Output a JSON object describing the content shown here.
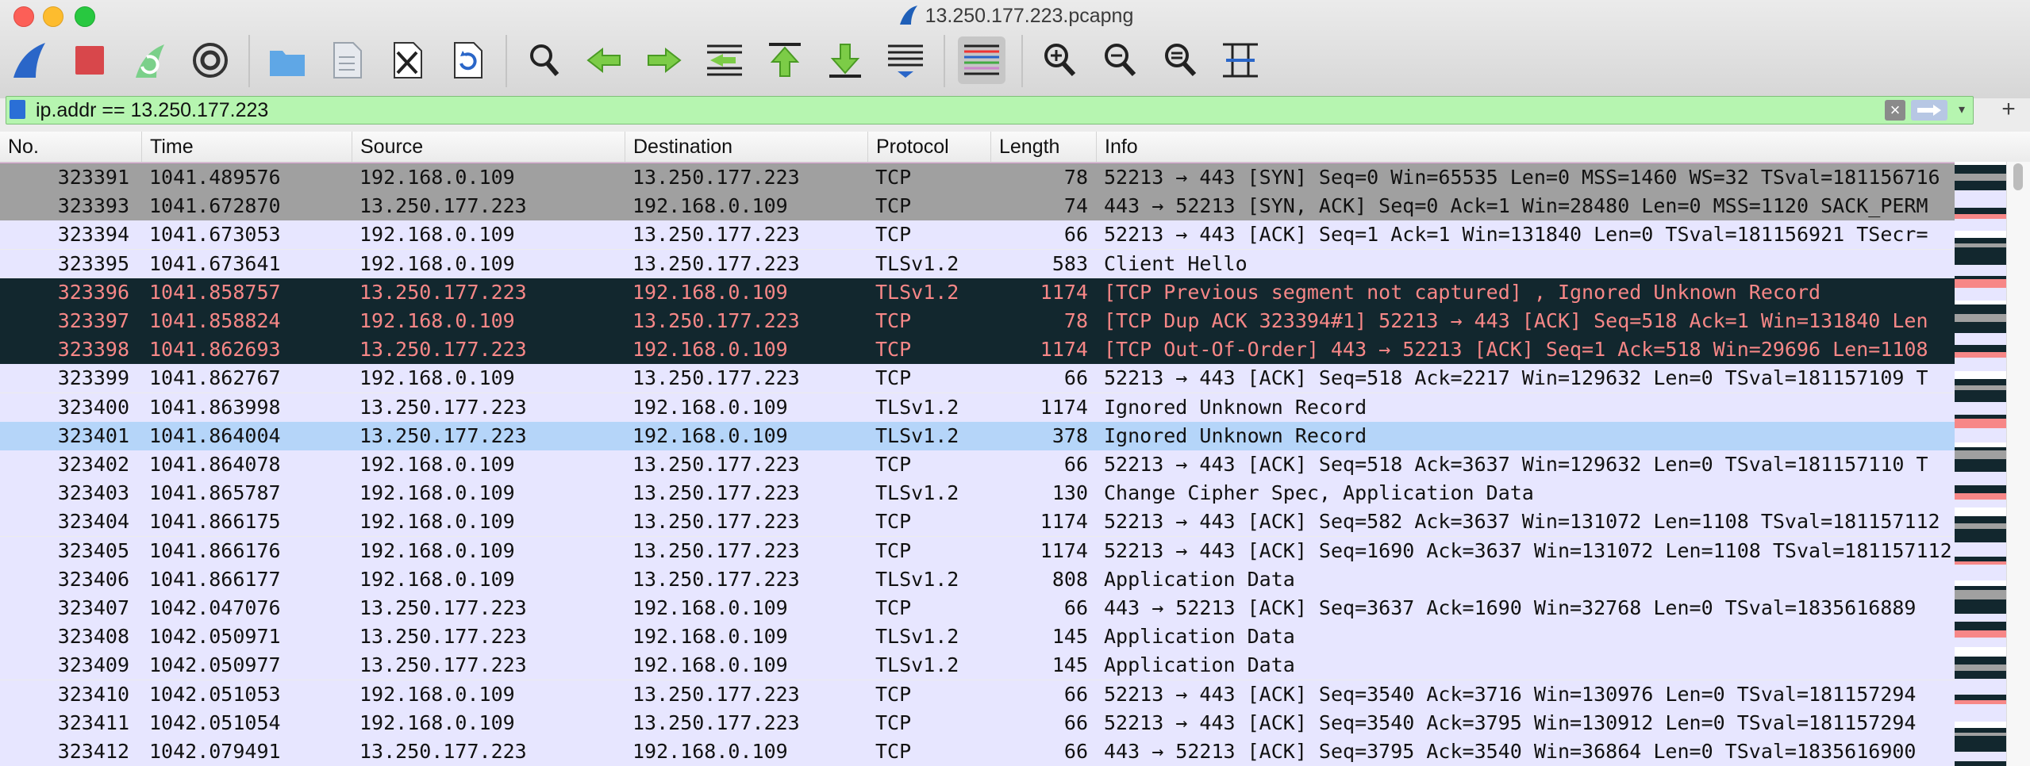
{
  "window": {
    "title": "13.250.177.223.pcapng"
  },
  "filter": {
    "value": "ip.addr == 13.250.177.223"
  },
  "columns": [
    "No.",
    "Time",
    "Source",
    "Destination",
    "Protocol",
    "Length",
    "Info"
  ],
  "colors": {
    "syn_bg": "#a0a0a0",
    "tcp_bg": "#e7e6ff",
    "bad_bg": "#12272e",
    "bad_fg": "#f78787",
    "selected_bg": "#b5d5f9",
    "filter_valid_bg": "#b6f5b0"
  },
  "rows": [
    {
      "no": "323391",
      "time": "1041.489576",
      "src": "192.168.0.109",
      "dst": "13.250.177.223",
      "proto": "TCP",
      "len": "78",
      "info": "52213 → 443 [SYN] Seq=0 Win=65535 Len=0 MSS=1460 WS=32 TSval=181156716",
      "style": "syn"
    },
    {
      "no": "323393",
      "time": "1041.672870",
      "src": "13.250.177.223",
      "dst": "192.168.0.109",
      "proto": "TCP",
      "len": "74",
      "info": "443 → 52213 [SYN, ACK] Seq=0 Ack=1 Win=28480 Len=0 MSS=1120 SACK_PERM",
      "style": "syn"
    },
    {
      "no": "323394",
      "time": "1041.673053",
      "src": "192.168.0.109",
      "dst": "13.250.177.223",
      "proto": "TCP",
      "len": "66",
      "info": "52213 → 443 [ACK] Seq=1 Ack=1 Win=131840 Len=0 TSval=181156921 TSecr=",
      "style": "tcp"
    },
    {
      "no": "323395",
      "time": "1041.673641",
      "src": "192.168.0.109",
      "dst": "13.250.177.223",
      "proto": "TLSv1.2",
      "len": "583",
      "info": "Client Hello",
      "style": "tcp"
    },
    {
      "no": "323396",
      "time": "1041.858757",
      "src": "13.250.177.223",
      "dst": "192.168.0.109",
      "proto": "TLSv1.2",
      "len": "1174",
      "info": "[TCP Previous segment not captured] , Ignored Unknown Record",
      "style": "bad"
    },
    {
      "no": "323397",
      "time": "1041.858824",
      "src": "192.168.0.109",
      "dst": "13.250.177.223",
      "proto": "TCP",
      "len": "78",
      "info": "[TCP Dup ACK 323394#1] 52213 → 443 [ACK] Seq=518 Ack=1 Win=131840 Len",
      "style": "bad"
    },
    {
      "no": "323398",
      "time": "1041.862693",
      "src": "13.250.177.223",
      "dst": "192.168.0.109",
      "proto": "TCP",
      "len": "1174",
      "info": "[TCP Out-Of-Order] 443 → 52213 [ACK] Seq=1 Ack=518 Win=29696 Len=1108",
      "style": "bad"
    },
    {
      "no": "323399",
      "time": "1041.862767",
      "src": "192.168.0.109",
      "dst": "13.250.177.223",
      "proto": "TCP",
      "len": "66",
      "info": "52213 → 443 [ACK] Seq=518 Ack=2217 Win=129632 Len=0 TSval=181157109 T",
      "style": "tcp"
    },
    {
      "no": "323400",
      "time": "1041.863998",
      "src": "13.250.177.223",
      "dst": "192.168.0.109",
      "proto": "TLSv1.2",
      "len": "1174",
      "info": "Ignored Unknown Record",
      "style": "tcp"
    },
    {
      "no": "323401",
      "time": "1041.864004",
      "src": "13.250.177.223",
      "dst": "192.168.0.109",
      "proto": "TLSv1.2",
      "len": "378",
      "info": "Ignored Unknown Record",
      "style": "selected"
    },
    {
      "no": "323402",
      "time": "1041.864078",
      "src": "192.168.0.109",
      "dst": "13.250.177.223",
      "proto": "TCP",
      "len": "66",
      "info": "52213 → 443 [ACK] Seq=518 Ack=3637 Win=129632 Len=0 TSval=181157110 T",
      "style": "tcp"
    },
    {
      "no": "323403",
      "time": "1041.865787",
      "src": "192.168.0.109",
      "dst": "13.250.177.223",
      "proto": "TLSv1.2",
      "len": "130",
      "info": "Change Cipher Spec, Application Data",
      "style": "tcp"
    },
    {
      "no": "323404",
      "time": "1041.866175",
      "src": "192.168.0.109",
      "dst": "13.250.177.223",
      "proto": "TCP",
      "len": "1174",
      "info": "52213 → 443 [ACK] Seq=582 Ack=3637 Win=131072 Len=1108 TSval=181157112",
      "style": "tcp"
    },
    {
      "no": "323405",
      "time": "1041.866176",
      "src": "192.168.0.109",
      "dst": "13.250.177.223",
      "proto": "TCP",
      "len": "1174",
      "info": "52213 → 443 [ACK] Seq=1690 Ack=3637 Win=131072 Len=1108 TSval=181157112",
      "style": "tcp"
    },
    {
      "no": "323406",
      "time": "1041.866177",
      "src": "192.168.0.109",
      "dst": "13.250.177.223",
      "proto": "TLSv1.2",
      "len": "808",
      "info": "Application Data",
      "style": "tcp"
    },
    {
      "no": "323407",
      "time": "1042.047076",
      "src": "13.250.177.223",
      "dst": "192.168.0.109",
      "proto": "TCP",
      "len": "66",
      "info": "443 → 52213 [ACK] Seq=3637 Ack=1690 Win=32768 Len=0 TSval=1835616889",
      "style": "tcp"
    },
    {
      "no": "323408",
      "time": "1042.050971",
      "src": "13.250.177.223",
      "dst": "192.168.0.109",
      "proto": "TLSv1.2",
      "len": "145",
      "info": "Application Data",
      "style": "tcp"
    },
    {
      "no": "323409",
      "time": "1042.050977",
      "src": "13.250.177.223",
      "dst": "192.168.0.109",
      "proto": "TLSv1.2",
      "len": "145",
      "info": "Application Data",
      "style": "tcp"
    },
    {
      "no": "323410",
      "time": "1042.051053",
      "src": "192.168.0.109",
      "dst": "13.250.177.223",
      "proto": "TCP",
      "len": "66",
      "info": "52213 → 443 [ACK] Seq=3540 Ack=3716 Win=130976 Len=0 TSval=181157294",
      "style": "tcp"
    },
    {
      "no": "323411",
      "time": "1042.051054",
      "src": "192.168.0.109",
      "dst": "13.250.177.223",
      "proto": "TCP",
      "len": "66",
      "info": "52213 → 443 [ACK] Seq=3540 Ack=3795 Win=130912 Len=0 TSval=181157294",
      "style": "tcp"
    },
    {
      "no": "323412",
      "time": "1042.079491",
      "src": "13.250.177.223",
      "dst": "192.168.0.109",
      "proto": "TCP",
      "len": "66",
      "info": "443 → 52213 [ACK] Seq=3795 Ack=3540 Win=36864 Len=0 TSval=1835616900",
      "style": "tcp"
    }
  ],
  "toolbar": [
    {
      "name": "start-capture-icon"
    },
    {
      "name": "stop-capture-icon"
    },
    {
      "name": "restart-capture-icon"
    },
    {
      "name": "capture-options-icon"
    },
    {
      "name": "open-file-icon"
    },
    {
      "name": "save-file-icon"
    },
    {
      "name": "close-file-icon"
    },
    {
      "name": "reload-file-icon"
    },
    {
      "name": "find-packet-icon"
    },
    {
      "name": "go-back-icon"
    },
    {
      "name": "go-forward-icon"
    },
    {
      "name": "go-to-packet-icon"
    },
    {
      "name": "go-first-packet-icon"
    },
    {
      "name": "go-last-packet-icon"
    },
    {
      "name": "autoscroll-icon"
    },
    {
      "name": "colorize-icon"
    },
    {
      "name": "zoom-in-icon"
    },
    {
      "name": "zoom-out-icon"
    },
    {
      "name": "normal-size-icon"
    },
    {
      "name": "resize-columns-icon"
    }
  ]
}
